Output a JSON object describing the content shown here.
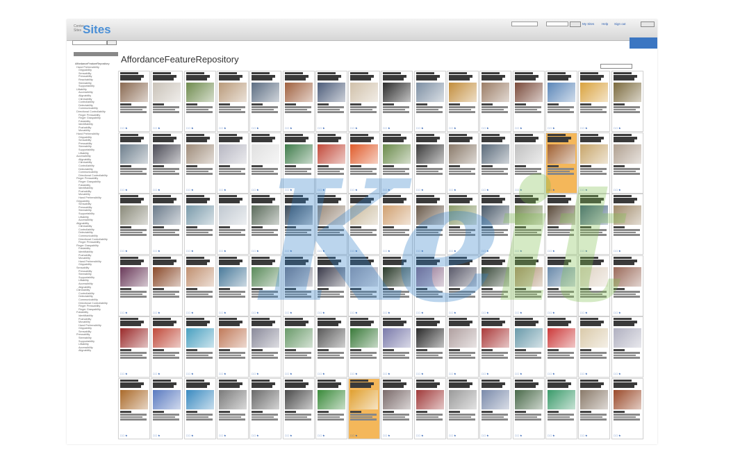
{
  "header": {
    "logo_small": "Center Sites",
    "logo_text": "Sites",
    "links": [
      "My Sites",
      "Help",
      "Sign out"
    ]
  },
  "page": {
    "title": "AffordanceFeatureRepository"
  },
  "watermark": {
    "text_main": "Ke",
    "text_accent": "it"
  },
  "sidebar": {
    "root": "AffordanceFeatureRepository",
    "items": [
      "Hand Prehensibility",
      "Grippability",
      "Sensability",
      "Pressability",
      "Reachability",
      "Steerability",
      "Supportability",
      "Liftability",
      "Accessibility",
      "Alignability",
      "Climbability",
      "Controllability",
      "Detectability",
      "Communicability",
      "Directional Controllability",
      "Finger Pressability",
      "Finger Graspability",
      "Foldability",
      "Identifiability",
      "Pushability",
      "Movability",
      "Hand Prehensibility",
      "Grippability",
      "Sensability",
      "Pressability",
      "Steerability",
      "Supportability",
      "Liftability",
      "Accessibility",
      "Alignability",
      "Climbability",
      "Controllability",
      "Detectability",
      "Communicability",
      "Directional Controllability",
      "Finger Pressability",
      "Finger Graspability",
      "Foldability",
      "Identifiability",
      "Pushability",
      "Movability",
      "Hand Prehensibility",
      "Grippability",
      "Sensability",
      "Pressability",
      "Steerability",
      "Supportability",
      "Liftability",
      "Accessibility",
      "Alignability",
      "Climbability",
      "Controllability",
      "Detectability",
      "Communicability",
      "Directional Controllability",
      "Finger Pressability",
      "Finger Graspability",
      "Foldability",
      "Identifiability",
      "Pushability",
      "Movability",
      "Hand Prehensibility",
      "Grippability",
      "Sensability",
      "Pressability",
      "Steerability",
      "Supportability",
      "Liftability",
      "Accessibility",
      "Alignability",
      "Climbability",
      "Controllability",
      "Detectability",
      "Communicability",
      "Directional Controllability",
      "Finger Pressability",
      "Finger Graspability",
      "Foldability",
      "Identifiability",
      "Pushability",
      "Movability",
      "Hand Prehensibility",
      "Grippability",
      "Sensability",
      "Pressability",
      "Steerability",
      "Supportability",
      "Liftability",
      "Accessibility",
      "Alignability"
    ]
  },
  "grid": {
    "rows": 6,
    "cols": 16,
    "highlighted": [
      [
        1,
        13
      ],
      [
        5,
        7
      ]
    ],
    "thumb_colors": [
      "#8a6a52",
      "#c9c2b8",
      "#6f8b4e",
      "#b99a7a",
      "#5c6d82",
      "#a0613f",
      "#4d5d7a",
      "#d0c0a9",
      "#2b2b2b",
      "#7d8fa3",
      "#c28d3c",
      "#9b7d66",
      "#7a4a3a",
      "#5b86b8",
      "#d9a23e",
      "#7b6a3d",
      "#6e7f8d",
      "#4a4a55",
      "#9f8c7a",
      "#b7b7c2",
      "#e0e0e0",
      "#3f7c4b",
      "#c24a3a",
      "#e05b2a",
      "#6a8a4a",
      "#3a3a3a",
      "#8a7a6a",
      "#5a6a7a",
      "#c0c0c0",
      "#a06030",
      "#c7a56a",
      "#b0a090",
      "#8a8a7a",
      "#6a7a8a",
      "#7a9aaa",
      "#c0c8d0",
      "#5a6a5a",
      "#3a4a5a",
      "#9a8a7a",
      "#c8b89a",
      "#d0a070",
      "#6a5a4a",
      "#8a9a6a",
      "#4a5a6a",
      "#7a8a5a",
      "#5a4a3a",
      "#3a5a7a",
      "#a08a6a",
      "#6a3a5a",
      "#8a4a2a",
      "#c09070",
      "#4a7a9a",
      "#5a8a5a",
      "#7a7a8a",
      "#3a3a4a",
      "#9a9aaa",
      "#2a3a2a",
      "#8a6a8a",
      "#5a5a6a",
      "#3a4a3a",
      "#aa8a6a",
      "#6a8aaa",
      "#ddd0c0",
      "#9a6a5a",
      "#9a2a2a",
      "#c04a3a",
      "#4aa0c0",
      "#c07a5a",
      "#8a8a9a",
      "#6a9a6a",
      "#5a5a5a",
      "#3a7a3a",
      "#7a7aaa",
      "#2a2a2a",
      "#b0a0a0",
      "#aa3a3a",
      "#6a9aaa",
      "#cc3a3a",
      "#dacaaa",
      "#b0b0c0",
      "#aa6a2a",
      "#5a7ac0",
      "#3a8ac0",
      "#7a7a7a",
      "#6a6a6a",
      "#4a4a4a",
      "#3a8a3a",
      "#e0a030",
      "#7a6a6a",
      "#a03a3a",
      "#9a9a9a",
      "#7a8aaa",
      "#4a6a4a",
      "#3a9a6a",
      "#8a7a6a",
      "#9a4a2a"
    ]
  }
}
